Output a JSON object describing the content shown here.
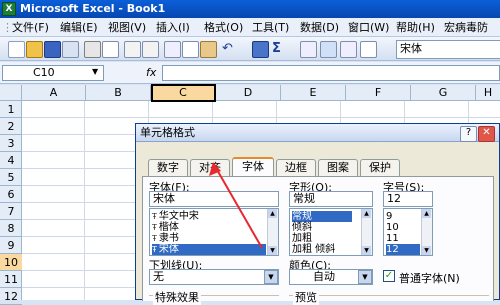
{
  "window": {
    "title": "Microsoft Excel - Book1",
    "app_icon": "X"
  },
  "menu": {
    "items": [
      "文件(F)",
      "编辑(E)",
      "视图(V)",
      "插入(I)",
      "格式(O)",
      "工具(T)",
      "数据(D)",
      "窗口(W)",
      "帮助(H)",
      "宏病毒防"
    ]
  },
  "toolbar": {
    "font_name": "宋体",
    "sigma": "Σ",
    "undo": "↶"
  },
  "formula_bar": {
    "name_box": "C10",
    "fx": "fx",
    "formula": ""
  },
  "grid": {
    "columns": [
      "A",
      "B",
      "C",
      "D",
      "E",
      "F",
      "G",
      "H"
    ],
    "rows": [
      "1",
      "2",
      "3",
      "4",
      "5",
      "6",
      "7",
      "8",
      "9",
      "10",
      "11",
      "12"
    ],
    "selected_column": "C",
    "selected_row": "10"
  },
  "dialog": {
    "title": "单元格格式",
    "help_button": "?",
    "close_button": "✕",
    "tabs": [
      "数字",
      "对齐",
      "字体",
      "边框",
      "图案",
      "保护"
    ],
    "active_tab": "字体",
    "font_label": "字体(F):",
    "font_value": "宋体",
    "font_list": [
      "华文中宋",
      "楷体",
      "隶书",
      "宋体"
    ],
    "font_selected": "宋体",
    "style_label": "字形(O):",
    "style_value": "常规",
    "style_list": [
      "常规",
      "倾斜",
      "加粗",
      "加粗 倾斜"
    ],
    "style_selected": "常规",
    "size_label": "字号(S):",
    "size_value": "12",
    "size_list": [
      "9",
      "10",
      "11",
      "12"
    ],
    "size_selected": "12",
    "underline_label": "下划线(U):",
    "underline_value": "无",
    "color_label": "颜色(C):",
    "color_value": "自动",
    "normal_font_label": "普通字体(N)",
    "normal_font_checked": true,
    "effects_label": "特殊效果",
    "preview_label": "预览"
  },
  "colors": {
    "title_bar": "#0a5fd8",
    "selection": "#316ac5",
    "annotation_arrow": "#e8282e",
    "active_tab_accent": "#e68b2c"
  }
}
